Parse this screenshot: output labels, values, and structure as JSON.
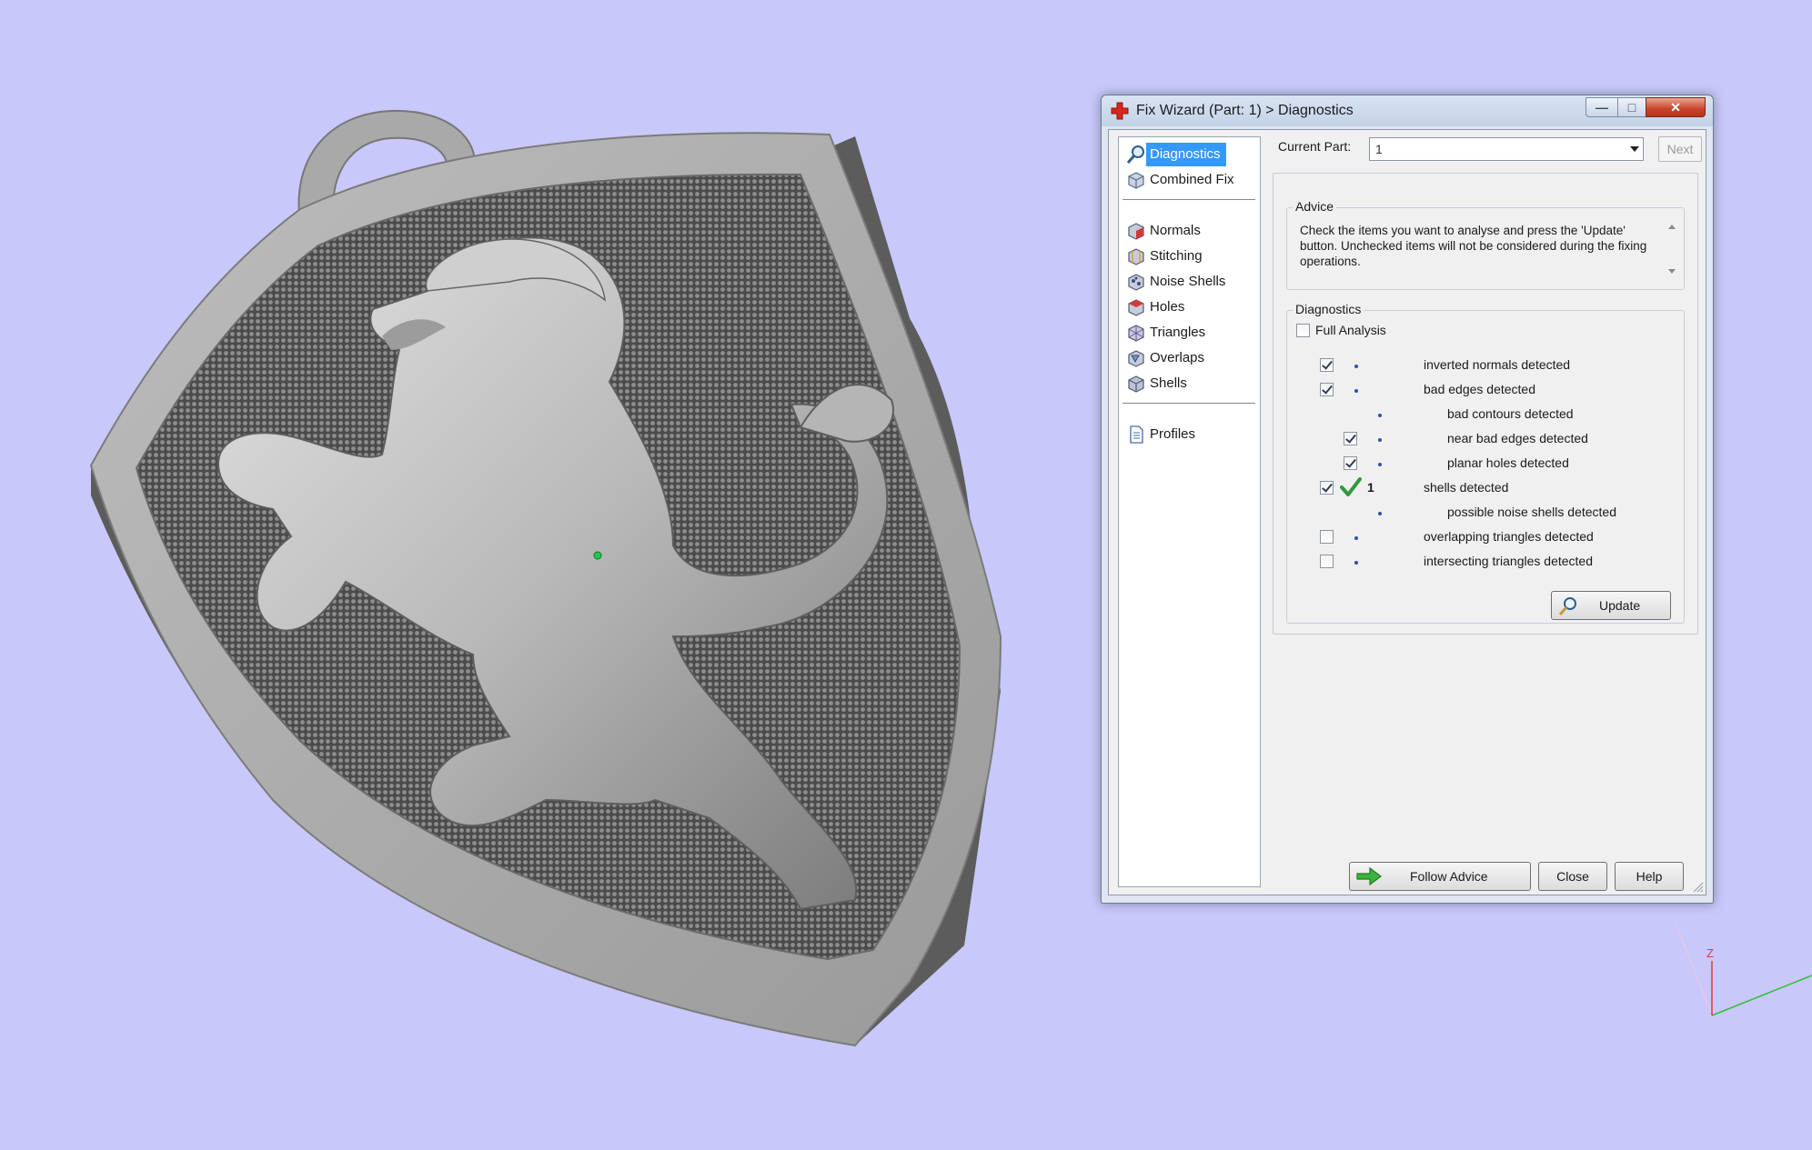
{
  "window": {
    "title": "Fix Wizard (Part: 1) > Diagnostics",
    "close_glyph": "✕",
    "maximize_glyph": "□",
    "minimize_glyph": "—"
  },
  "nav": {
    "top": [
      {
        "label": "Diagnostics",
        "icon": "magnifier-icon",
        "selected": true
      },
      {
        "label": "Combined Fix",
        "icon": "cube-icon",
        "selected": false
      }
    ],
    "tools": [
      {
        "label": "Normals",
        "icon": "normals-cube-icon"
      },
      {
        "label": "Stitching",
        "icon": "stitching-cube-icon"
      },
      {
        "label": "Noise Shells",
        "icon": "noise-shells-icon"
      },
      {
        "label": "Holes",
        "icon": "holes-cube-icon"
      },
      {
        "label": "Triangles",
        "icon": "triangles-cube-icon"
      },
      {
        "label": "Overlaps",
        "icon": "overlaps-cube-icon"
      },
      {
        "label": "Shells",
        "icon": "shells-cube-icon"
      }
    ],
    "bottom": [
      {
        "label": "Profiles",
        "icon": "document-icon"
      }
    ]
  },
  "current_part": {
    "label": "Current Part:",
    "value": "1",
    "next_label": "Next"
  },
  "advice": {
    "legend": "Advice",
    "text": "Check the items you want to analyse and press the 'Update' button. Unchecked items will not be considered during the fixing operations."
  },
  "diagnostics": {
    "legend": "Diagnostics",
    "full_analysis": {
      "label": "Full Analysis",
      "checked": false
    },
    "rows": [
      {
        "label": "inverted normals detected",
        "checked": true,
        "indent": 0,
        "status": "dot",
        "count": ""
      },
      {
        "label": "bad edges detected",
        "checked": true,
        "indent": 0,
        "status": "dot",
        "count": ""
      },
      {
        "label": "bad contours detected",
        "checked": null,
        "indent": 1,
        "status": "dot",
        "count": ""
      },
      {
        "label": "near bad edges detected",
        "checked": true,
        "indent": 1,
        "status": "dot",
        "count": ""
      },
      {
        "label": "planar holes detected",
        "checked": true,
        "indent": 1,
        "status": "dot",
        "count": ""
      },
      {
        "label": "shells detected",
        "checked": true,
        "indent": 0,
        "status": "ok",
        "count": "1"
      },
      {
        "label": "possible noise shells detected",
        "checked": null,
        "indent": 1,
        "status": "dot",
        "count": ""
      },
      {
        "label": "overlapping triangles detected",
        "checked": false,
        "indent": 0,
        "status": "dot",
        "count": ""
      },
      {
        "label": "intersecting triangles detected",
        "checked": false,
        "indent": 0,
        "status": "dot",
        "count": ""
      }
    ],
    "update_label": "Update"
  },
  "buttons": {
    "follow_advice": "Follow Advice",
    "close": "Close",
    "help": "Help"
  },
  "axes": {
    "z_label": "Z"
  },
  "colors": {
    "background": "#c8c8fa",
    "selection": "#3399ff",
    "close_button": "#c7442b",
    "checkmark_ok": "#2e9a3c",
    "arrow_green": "#3cb43c"
  }
}
